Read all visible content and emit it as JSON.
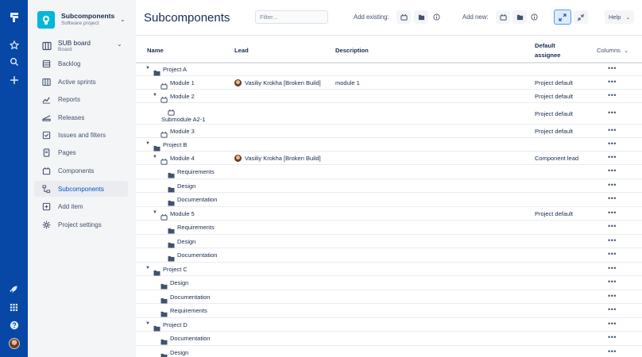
{
  "project": {
    "name": "Subcomponents",
    "type": "Software project"
  },
  "board": {
    "name": "SUB board",
    "sub": "Board"
  },
  "nav": [
    {
      "label": "Backlog",
      "icon": "backlog-icon"
    },
    {
      "label": "Active sprints",
      "icon": "active-sprints-icon"
    },
    {
      "label": "Reports",
      "icon": "reports-icon"
    },
    {
      "label": "Releases",
      "icon": "releases-icon"
    },
    {
      "label": "Issues and filters",
      "icon": "issues-icon"
    },
    {
      "label": "Pages",
      "icon": "pages-icon"
    },
    {
      "label": "Components",
      "icon": "components-icon"
    },
    {
      "label": "Subcomponents",
      "icon": "subcomponents-icon",
      "active": true
    },
    {
      "label": "Add item",
      "icon": "add-item-icon"
    },
    {
      "label": "Project settings",
      "icon": "settings-icon"
    }
  ],
  "page": {
    "title": "Subcomponents"
  },
  "toolbar": {
    "filter_placeholder": "Filter...",
    "add_existing_label": "Add existing:",
    "add_new_label": "Add new:",
    "help_label": "Help"
  },
  "table": {
    "headers": {
      "name": "Name",
      "lead": "Lead",
      "description": "Description",
      "assignee_line1": "Default",
      "assignee_line2": "assignee",
      "columns": "Columns"
    },
    "more": "•••",
    "rows": [
      {
        "name": "Project A",
        "type": "project",
        "expanded": true,
        "lead": "",
        "description": "",
        "assignee": ""
      },
      {
        "name": "Module 1",
        "type": "module",
        "expanded": false,
        "lead": "Vasiliy Krokha [Broken Build]",
        "description": "module 1",
        "assignee": "Project default"
      },
      {
        "name": "Module 2",
        "type": "module",
        "expanded": true,
        "lead": "",
        "description": "",
        "assignee": "Project default"
      },
      {
        "name": "Submodule A2-1",
        "type": "submodule",
        "expanded": false,
        "lead": "",
        "description": "",
        "assignee": "Project default"
      },
      {
        "name": "Module 3",
        "type": "module",
        "expanded": false,
        "lead": "",
        "description": "",
        "assignee": "Project default"
      },
      {
        "name": "Project B",
        "type": "project",
        "expanded": true,
        "lead": "",
        "description": "",
        "assignee": ""
      },
      {
        "name": "Module 4",
        "type": "module",
        "expanded": true,
        "lead": "Vasiliy Krokha [Broken Build]",
        "description": "",
        "assignee": "Component lead"
      },
      {
        "name": "Requirements",
        "type": "folder",
        "level": 2,
        "lead": "",
        "description": "",
        "assignee": ""
      },
      {
        "name": "Design",
        "type": "folder",
        "level": 2,
        "lead": "",
        "description": "",
        "assignee": ""
      },
      {
        "name": "Documentation",
        "type": "folder",
        "level": 2,
        "lead": "",
        "description": "",
        "assignee": ""
      },
      {
        "name": "Module 5",
        "type": "module",
        "expanded": true,
        "lead": "",
        "description": "",
        "assignee": "Project default"
      },
      {
        "name": "Requirements",
        "type": "folder",
        "level": 2,
        "lead": "",
        "description": "",
        "assignee": ""
      },
      {
        "name": "Design",
        "type": "folder",
        "level": 2,
        "lead": "",
        "description": "",
        "assignee": ""
      },
      {
        "name": "Documentation",
        "type": "folder",
        "level": 2,
        "lead": "",
        "description": "",
        "assignee": ""
      },
      {
        "name": "Project C",
        "type": "project",
        "expanded": true,
        "lead": "",
        "description": "",
        "assignee": ""
      },
      {
        "name": "Design",
        "type": "folder",
        "level": 1,
        "lead": "",
        "description": "",
        "assignee": ""
      },
      {
        "name": "Documentation",
        "type": "folder",
        "level": 1,
        "lead": "",
        "description": "",
        "assignee": ""
      },
      {
        "name": "Requirements",
        "type": "folder",
        "level": 1,
        "lead": "",
        "description": "",
        "assignee": ""
      },
      {
        "name": "Project D",
        "type": "project",
        "expanded": true,
        "lead": "",
        "description": "",
        "assignee": ""
      },
      {
        "name": "Documentation",
        "type": "folder",
        "level": 1,
        "lead": "",
        "description": "",
        "assignee": ""
      },
      {
        "name": "Design",
        "type": "folder",
        "level": 1,
        "lead": "",
        "description": "",
        "assignee": ""
      }
    ]
  },
  "colors": {
    "global_nav": "#0747a6",
    "sidebar_bg": "#f4f5f7",
    "accent": "#0052cc",
    "project_logo": "#00b8d9"
  }
}
